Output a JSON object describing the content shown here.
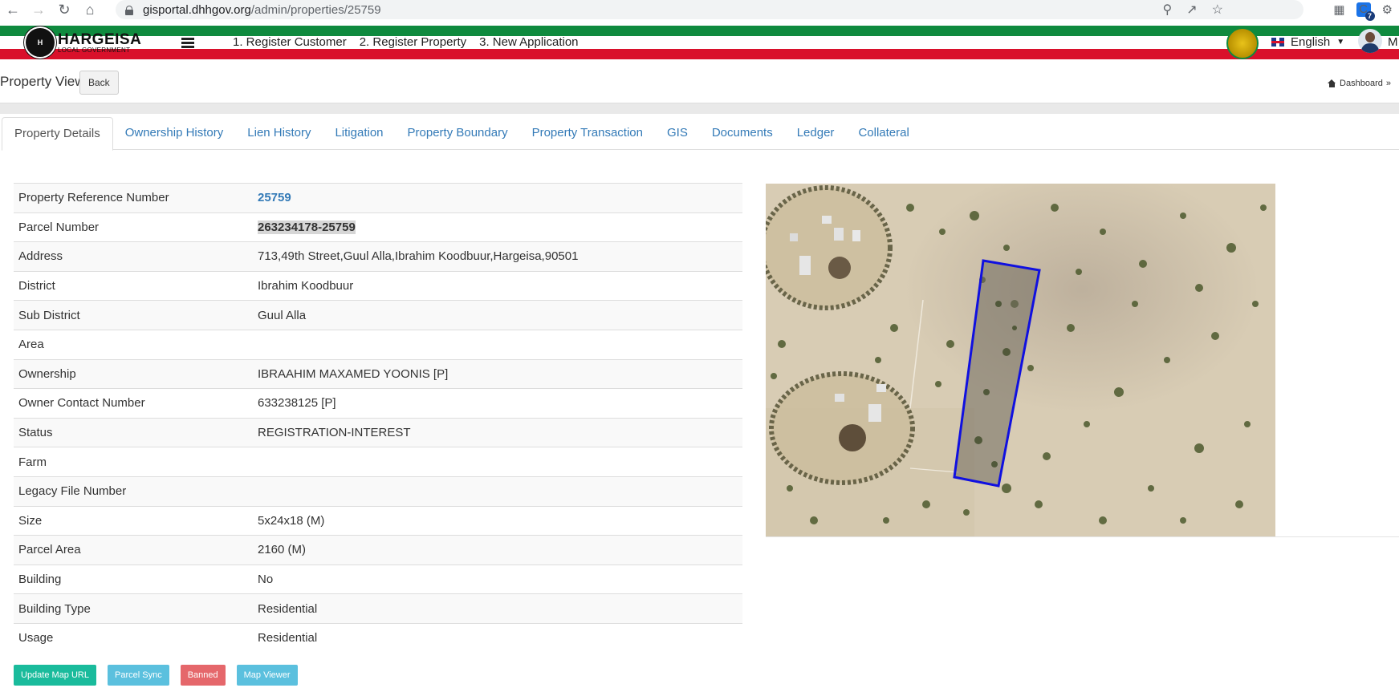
{
  "browser": {
    "url_host": "gisportal.dhhgov.org",
    "url_path": "/admin/properties/25759",
    "ext_badge_count": "7"
  },
  "header": {
    "logo_title": "HARGEISA",
    "logo_subtitle": "LOCAL GOVERNMENT",
    "nav": [
      "1. Register Customer",
      "2. Register Property",
      "3. New Application"
    ],
    "language": "English",
    "user_initial": "M"
  },
  "page": {
    "title": "Property View",
    "back_label": "Back",
    "breadcrumb": "Dashboard",
    "breadcrumb_sep": "»"
  },
  "tabs": [
    "Property Details",
    "Ownership History",
    "Lien History",
    "Litigation",
    "Property Boundary",
    "Property Transaction",
    "GIS",
    "Documents",
    "Ledger",
    "Collateral"
  ],
  "details": [
    {
      "label": "Property Reference Number",
      "value": "25759"
    },
    {
      "label": "Parcel Number",
      "value": "263234178-25759"
    },
    {
      "label": "Address",
      "value": "713,49th Street,Guul Alla,Ibrahim Koodbuur,Hargeisa,90501"
    },
    {
      "label": "District",
      "value": "Ibrahim Koodbuur"
    },
    {
      "label": "Sub District",
      "value": "Guul Alla"
    },
    {
      "label": "Area",
      "value": ""
    },
    {
      "label": "Ownership",
      "value": "IBRAAHIM MAXAMED YOONIS [P]"
    },
    {
      "label": "Owner Contact Number",
      "value": "633238125 [P]"
    },
    {
      "label": "Status",
      "value": "REGISTRATION-INTEREST"
    },
    {
      "label": "Farm",
      "value": ""
    },
    {
      "label": "Legacy File Number",
      "value": ""
    },
    {
      "label": "Size",
      "value": "5x24x18 (M)"
    },
    {
      "label": "Parcel Area",
      "value": "2160 (M)"
    },
    {
      "label": "Building",
      "value": "No"
    },
    {
      "label": "Building Type",
      "value": "Residential"
    },
    {
      "label": "Usage",
      "value": "Residential"
    }
  ],
  "actions": {
    "update_map": "Update Map URL",
    "parcel_sync": "Parcel Sync",
    "banned": "Banned",
    "map_viewer": "Map Viewer"
  },
  "colors": {
    "flag_green": "#0f8a3e",
    "flag_red": "#d9102b",
    "link_blue": "#337ab7",
    "parcel_outline": "#1010e0"
  }
}
